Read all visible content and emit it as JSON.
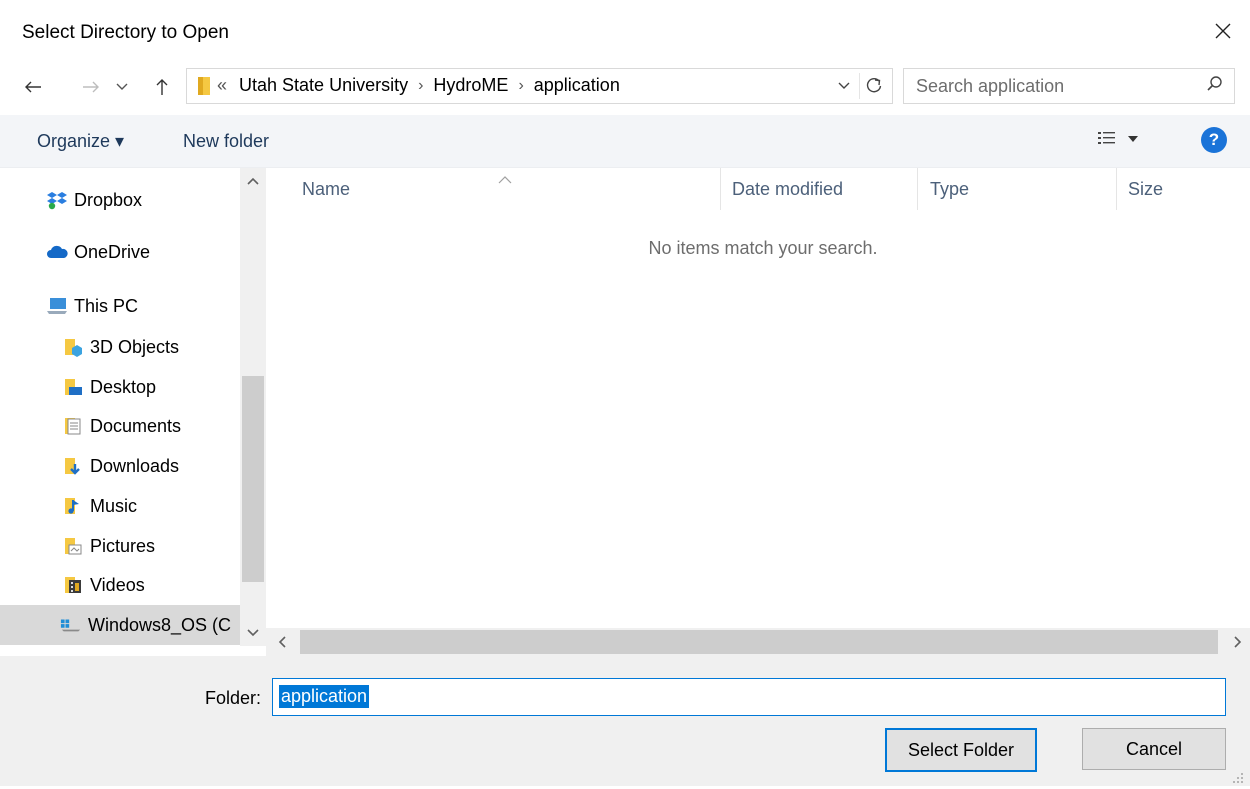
{
  "window": {
    "title": "Select Directory to Open"
  },
  "nav": {
    "back_icon": "arrow-left-icon",
    "forward_icon": "arrow-right-icon",
    "recent_icon": "chevron-down-icon",
    "up_icon": "arrow-up-icon",
    "breadcrumbs": [
      "«",
      "Utah State University",
      "HydroME",
      "application"
    ],
    "search_placeholder": "Search application"
  },
  "toolbar": {
    "organize_label": "Organize ▾",
    "new_folder_label": "New folder",
    "help_label": "?"
  },
  "sidebar": {
    "items": [
      {
        "label": "Dropbox",
        "icon": "dropbox-icon"
      },
      {
        "label": "OneDrive",
        "icon": "onedrive-cloud-icon"
      },
      {
        "label": "This PC",
        "icon": "computer-icon"
      },
      {
        "label": "3D Objects",
        "icon": "3d-objects-folder-icon"
      },
      {
        "label": "Desktop",
        "icon": "desktop-folder-icon"
      },
      {
        "label": "Documents",
        "icon": "documents-folder-icon"
      },
      {
        "label": "Downloads",
        "icon": "downloads-folder-icon"
      },
      {
        "label": "Music",
        "icon": "music-folder-icon"
      },
      {
        "label": "Pictures",
        "icon": "pictures-folder-icon"
      },
      {
        "label": "Videos",
        "icon": "videos-folder-icon"
      },
      {
        "label": "Windows8_OS (C",
        "icon": "drive-icon",
        "selected": true
      }
    ]
  },
  "filelist": {
    "columns": [
      "Name",
      "Date modified",
      "Type",
      "Size"
    ],
    "empty_message": "No items match your search."
  },
  "bottom": {
    "folder_label": "Folder:",
    "folder_value": "application",
    "select_button": "Select Folder",
    "cancel_button": "Cancel"
  },
  "colors": {
    "accent": "#0078d7",
    "toolbar_bg": "#f3f5f8",
    "help": "#1a73d8",
    "folder_yellow": "#f5c842"
  }
}
